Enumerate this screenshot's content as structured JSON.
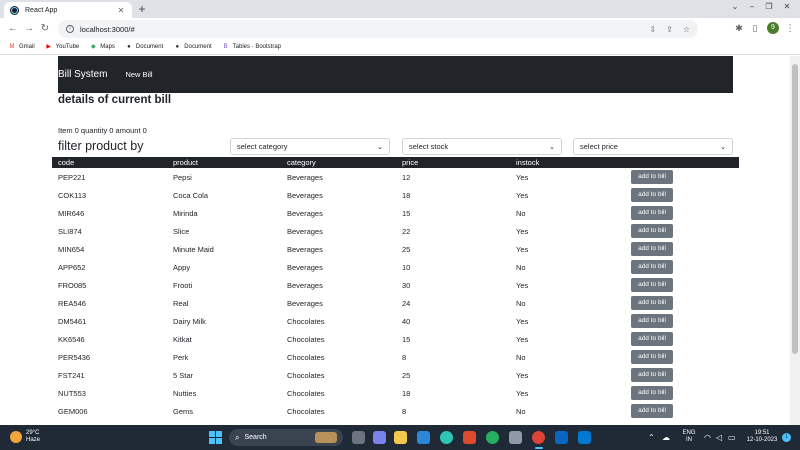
{
  "browser": {
    "tab_title": "React App",
    "tab_close": "✕",
    "new_tab": "+",
    "url": "localhost:3000/#",
    "bookmarks": [
      {
        "label": "Gmail",
        "icon": "gmail-icon",
        "color": "#ea4335",
        "glyph": "M"
      },
      {
        "label": "YouTube",
        "icon": "youtube-icon",
        "color": "#ff0000",
        "glyph": "▶"
      },
      {
        "label": "Maps",
        "icon": "maps-icon",
        "color": "#34a853",
        "glyph": "◆"
      },
      {
        "label": "Document",
        "icon": "github-icon",
        "color": "#24292f",
        "glyph": "●"
      },
      {
        "label": "Document",
        "icon": "github-icon",
        "color": "#24292f",
        "glyph": "●"
      },
      {
        "label": "Tables · Bootstrap",
        "icon": "bootstrap-icon",
        "color": "#7952b3",
        "glyph": "B"
      }
    ],
    "profile_initial": "9"
  },
  "navbar": {
    "brand": "Bill System",
    "link": "New Bill"
  },
  "bill": {
    "heading": "details of current bill",
    "summary": "Item 0 quantity 0 amount 0"
  },
  "filter": {
    "title": "filter product by",
    "category_placeholder": "select category",
    "stock_placeholder": "select stock",
    "price_placeholder": "select price"
  },
  "table": {
    "headers": [
      "code",
      "product",
      "category",
      "price",
      "instock"
    ],
    "button_label": "add to bill",
    "rows": [
      {
        "code": "PEP221",
        "product": "Pepsi",
        "category": "Beverages",
        "price": "12",
        "instock": "Yes"
      },
      {
        "code": "COK113",
        "product": "Coca Cola",
        "category": "Beverages",
        "price": "18",
        "instock": "Yes"
      },
      {
        "code": "MIR646",
        "product": "Mirinda",
        "category": "Beverages",
        "price": "15",
        "instock": "No"
      },
      {
        "code": "SLI874",
        "product": "Slice",
        "category": "Beverages",
        "price": "22",
        "instock": "Yes"
      },
      {
        "code": "MIN654",
        "product": "Minute Maid",
        "category": "Beverages",
        "price": "25",
        "instock": "Yes"
      },
      {
        "code": "APP652",
        "product": "Appy",
        "category": "Beverages",
        "price": "10",
        "instock": "No"
      },
      {
        "code": "FRO085",
        "product": "Frooti",
        "category": "Beverages",
        "price": "30",
        "instock": "Yes"
      },
      {
        "code": "REA546",
        "product": "Real",
        "category": "Beverages",
        "price": "24",
        "instock": "No"
      },
      {
        "code": "DM5461",
        "product": "Dairy Milk",
        "category": "Chocolates",
        "price": "40",
        "instock": "Yes"
      },
      {
        "code": "KK6546",
        "product": "Kitkat",
        "category": "Chocolates",
        "price": "15",
        "instock": "Yes"
      },
      {
        "code": "PER5436",
        "product": "Perk",
        "category": "Chocolates",
        "price": "8",
        "instock": "No"
      },
      {
        "code": "FST241",
        "product": "5 Star",
        "category": "Chocolates",
        "price": "25",
        "instock": "Yes"
      },
      {
        "code": "NUT553",
        "product": "Nutties",
        "category": "Chocolates",
        "price": "18",
        "instock": "Yes"
      },
      {
        "code": "GEM006",
        "product": "Gems",
        "category": "Chocolates",
        "price": "8",
        "instock": "No"
      }
    ]
  },
  "taskbar": {
    "temperature": "29°C",
    "weather": "Haze",
    "search": "Search",
    "lang_top": "ENG",
    "lang_bottom": "IN",
    "time": "19:51",
    "date": "12-10-2023",
    "notifications": "1",
    "accent": "#4cc2ff"
  }
}
